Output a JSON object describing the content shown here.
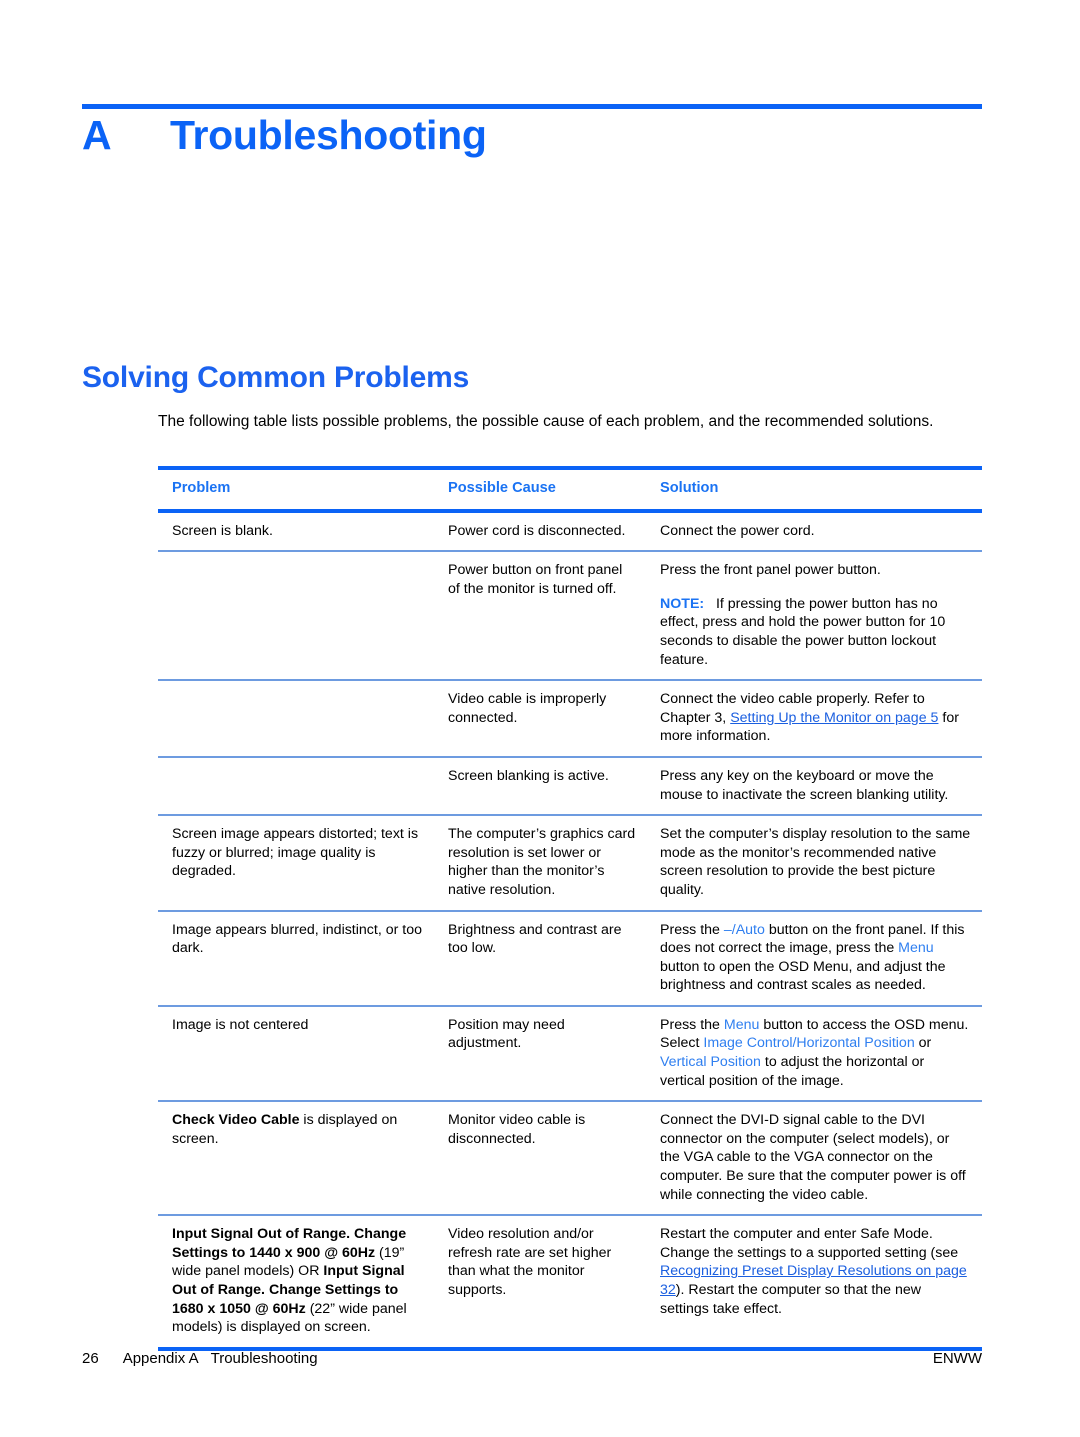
{
  "colors": {
    "accent": "#0b63f6",
    "heading": "#1b62ef",
    "link": "#1b5fe0",
    "ui_term": "#2f7ff0"
  },
  "chapter": {
    "letter": "A",
    "title": "Troubleshooting"
  },
  "section": {
    "title": "Solving Common Problems",
    "intro": "The following table lists possible problems, the possible cause of each problem, and the recommended solutions."
  },
  "table": {
    "headers": [
      "Problem",
      "Possible Cause",
      "Solution"
    ],
    "rows": [
      {
        "problem": "Screen is blank.",
        "cause": "Power cord is disconnected.",
        "solution_paras": [
          [
            {
              "t": "Connect the power cord."
            }
          ]
        ]
      },
      {
        "problem": "",
        "cause": "Power button on front panel of the monitor is turned off.",
        "solution_paras": [
          [
            {
              "t": "Press the front panel power button."
            }
          ],
          [
            {
              "t": "NOTE:",
              "style": "note"
            },
            {
              "t": "   If pressing the power button has no effect, press and hold the power button for 10 seconds to disable the power button lockout feature."
            }
          ]
        ]
      },
      {
        "problem": "",
        "cause": "Video cable is improperly connected.",
        "solution_paras": [
          [
            {
              "t": "Connect the video cable properly. Refer to Chapter 3, "
            },
            {
              "t": "Setting Up the Monitor on page 5",
              "style": "xref"
            },
            {
              "t": " for more information."
            }
          ]
        ]
      },
      {
        "problem": "",
        "cause": "Screen blanking is active.",
        "solution_paras": [
          [
            {
              "t": "Press any key on the keyboard or move the mouse to inactivate the screen blanking utility."
            }
          ]
        ]
      },
      {
        "problem": "Screen image appears distorted; text is fuzzy or blurred; image quality is degraded.",
        "cause": "The computer’s graphics card resolution is set lower or higher than the monitor’s native resolution.",
        "solution_paras": [
          [
            {
              "t": "Set the computer’s display resolution to the same mode as the monitor’s recommended native screen resolution to provide the best picture quality."
            }
          ]
        ]
      },
      {
        "problem": "Image appears blurred, indistinct, or too dark.",
        "cause": "Brightness and contrast are too low.",
        "solution_paras": [
          [
            {
              "t": "Press the "
            },
            {
              "t": "–/Auto",
              "style": "ui"
            },
            {
              "t": " button on the front panel. If this does not correct the image, press the "
            },
            {
              "t": "Menu",
              "style": "ui"
            },
            {
              "t": " button to open the OSD Menu, and adjust the brightness and contrast scales as needed."
            }
          ]
        ]
      },
      {
        "problem": "Image is not centered",
        "cause": "Position may need adjustment.",
        "solution_paras": [
          [
            {
              "t": "Press the "
            },
            {
              "t": "Menu",
              "style": "ui"
            },
            {
              "t": " button to access the OSD menu. Select "
            },
            {
              "t": "Image Control/Horizontal Position",
              "style": "ui"
            },
            {
              "t": " or "
            },
            {
              "t": "Vertical Position",
              "style": "ui"
            },
            {
              "t": " to adjust the horizontal or vertical position of the image."
            }
          ]
        ]
      },
      {
        "problem_parts": [
          {
            "t": "Check Video Cable",
            "style": "bold"
          },
          {
            "t": " is displayed on screen."
          }
        ],
        "cause": "Monitor video cable is disconnected.",
        "solution_paras": [
          [
            {
              "t": "Connect the DVI-D signal cable to the DVI connector on the computer (select models), or the VGA cable to the VGA connector on the computer. Be sure that the computer power is off while connecting the video cable."
            }
          ]
        ]
      },
      {
        "problem_parts": [
          {
            "t": "Input Signal Out of Range. Change Settings to 1440 x 900 @ 60Hz",
            "style": "bold"
          },
          {
            "t": " (19” wide panel models) OR "
          },
          {
            "t": "Input Signal Out of Range. Change Settings to 1680 x 1050 @ 60Hz",
            "style": "bold"
          },
          {
            "t": " (22” wide panel models) is displayed on screen."
          }
        ],
        "cause": "Video resolution and/or refresh rate are set higher than what the monitor supports.",
        "solution_paras": [
          [
            {
              "t": "Restart the computer and enter Safe Mode. Change the settings to a supported setting (see "
            },
            {
              "t": "Recognizing Preset Display Resolutions on page 32",
              "style": "xref"
            },
            {
              "t": "). Restart the computer so that the new settings take effect."
            }
          ]
        ]
      }
    ]
  },
  "footer": {
    "page_number": "26",
    "appendix": "Appendix A",
    "chapter_title": "Troubleshooting",
    "right": "ENWW"
  }
}
